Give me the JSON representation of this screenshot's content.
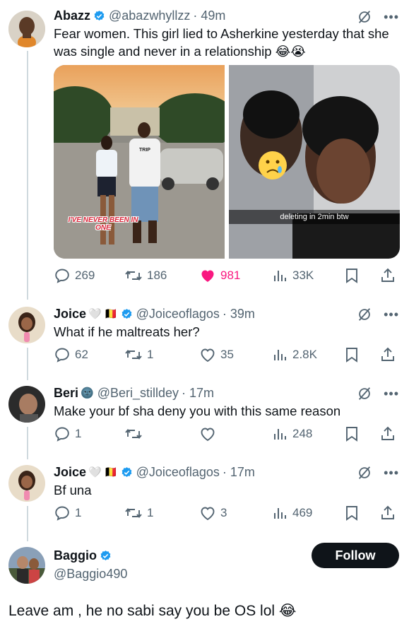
{
  "colors": {
    "like_pink": "#f91880",
    "muted": "#536471",
    "verified_blue": "#1d9bf0",
    "line": "#cfd9de"
  },
  "tweet1": {
    "name": "Abazz",
    "handle": "@abazwhyllzz",
    "time": "· 49m",
    "text": "Fear women. This girl lied to Asherkine yesterday that she was single and never in a relationship",
    "emojis": "😂😭",
    "media": {
      "left_caption": "I'VE NEVER BEEN IN ONE",
      "left_shirt": "TRIP",
      "right_caption": "deleting in 2min btw",
      "right_sticker": "😢"
    },
    "actions": {
      "replies": "269",
      "reposts": "186",
      "likes": "981",
      "views": "33K",
      "liked": true
    }
  },
  "reply1": {
    "name": "Joice",
    "flag_emoji": "🤍 🇧🇪",
    "handle": "@Joiceoflagos",
    "time": "· 39m",
    "text": "What if he maltreats her?",
    "actions": {
      "replies": "62",
      "reposts": "1",
      "likes": "35",
      "views": "2.8K"
    }
  },
  "reply2": {
    "name": "Beri",
    "name_emoji": "🌚",
    "handle": "@Beri_stilldey",
    "time": "· 17m",
    "text": "Make your bf sha deny you with this same reason",
    "actions": {
      "replies": "1",
      "reposts": "",
      "likes": "",
      "views": "248"
    }
  },
  "reply3": {
    "name": "Joice",
    "flag_emoji": "🤍 🇧🇪",
    "handle": "@Joiceoflagos",
    "time": "· 17m",
    "text": "Bf una",
    "actions": {
      "replies": "1",
      "reposts": "1",
      "likes": "3",
      "views": "469"
    }
  },
  "main_tweet": {
    "name": "Baggio",
    "handle": "@Baggio490",
    "follow_label": "Follow",
    "text": "Leave am , he no sabi say you be OS lol",
    "emoji": "😂"
  },
  "icons": [
    "grok-icon",
    "more-icon",
    "reply-icon",
    "repost-icon",
    "like-icon",
    "views-icon",
    "bookmark-icon",
    "share-icon",
    "verified-icon"
  ]
}
